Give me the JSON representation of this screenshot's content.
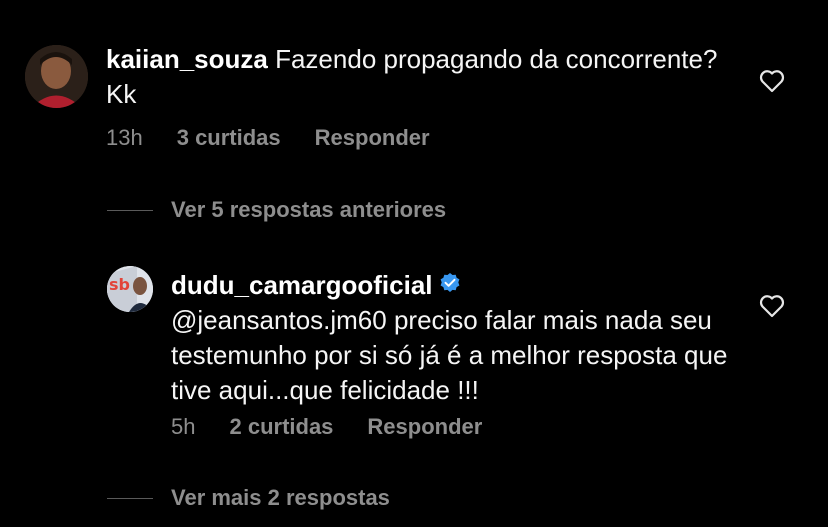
{
  "comments": [
    {
      "username": "kaiian_souza",
      "text": "Fazendo propagando da concorrente? Kk",
      "time": "13h",
      "likes": "3 curtidas",
      "reply_label": "Responder"
    },
    {
      "username": "dudu_camargooficial",
      "verified": true,
      "text": "@jeansantos.jm60 preciso falar mais nada seu testemunho por si só já é a melhor resposta que tive aqui...que felicidade !!!",
      "time": "5h",
      "likes": "2 curtidas",
      "reply_label": "Responder"
    }
  ],
  "view_previous_replies": "Ver 5 respostas anteriores",
  "view_more_replies": "Ver mais 2 respostas",
  "colors": {
    "background": "#000000",
    "text": "#ffffff",
    "muted": "#8e8e8e",
    "verified_badge": "#3897f0"
  },
  "icons": {
    "like": "heart-outline-icon",
    "verified": "verified-badge-icon"
  }
}
